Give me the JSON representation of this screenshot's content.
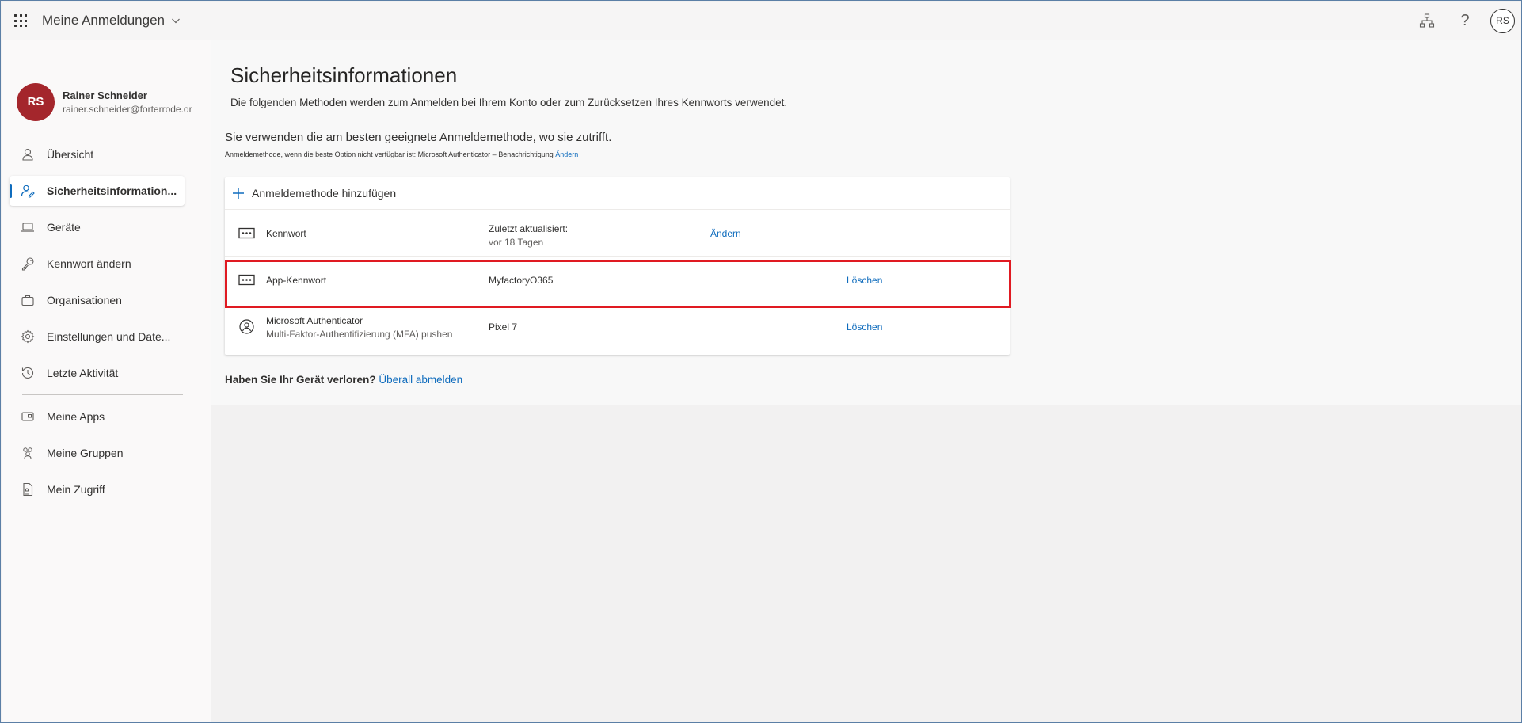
{
  "header": {
    "app_title": "Meine Anmeldungen",
    "help_label": "?",
    "avatar_initials": "RS"
  },
  "sidebar": {
    "user": {
      "initials": "RS",
      "name": "Rainer Schneider",
      "email": "rainer.schneider@forterrode.or"
    },
    "items": [
      {
        "label": "Übersicht",
        "icon": "person-icon"
      },
      {
        "label": "Sicherheitsinformation...",
        "icon": "security-info-icon",
        "active": true
      },
      {
        "label": "Geräte",
        "icon": "laptop-icon"
      },
      {
        "label": "Kennwort ändern",
        "icon": "key-icon"
      },
      {
        "label": "Organisationen",
        "icon": "briefcase-icon"
      },
      {
        "label": "Einstellungen und Date...",
        "icon": "gear-icon"
      },
      {
        "label": "Letzte Aktivität",
        "icon": "history-icon"
      }
    ],
    "secondary_items": [
      {
        "label": "Meine Apps",
        "icon": "apps-icon"
      },
      {
        "label": "Meine Gruppen",
        "icon": "groups-icon"
      },
      {
        "label": "Mein Zugriff",
        "icon": "access-icon"
      }
    ]
  },
  "main": {
    "title": "Sicherheitsinformationen",
    "subtitle": "Die folgenden Methoden werden zum Anmelden bei Ihrem Konto oder zum Zurücksetzen Ihres Kennworts verwendet.",
    "default_method_text": "Sie verwenden die am besten geeignete Anmeldemethode, wo sie zutrifft.",
    "default_method_small": "Anmeldemethode, wenn die beste Option nicht verfügbar ist: Microsoft Authenticator – Benachrichtigung",
    "default_method_change": "Ändern",
    "add_method_label": "Anmeldemethode hinzufügen",
    "methods": [
      {
        "name": "Kennwort",
        "detail": "Zuletzt aktualisiert:",
        "detail_sub": "vor 18 Tagen",
        "action": "Ändern",
        "icon": "password-dots-icon"
      },
      {
        "name": "App-Kennwort",
        "detail": "MyfactoryO365",
        "action": "Löschen",
        "icon": "password-dots-icon"
      },
      {
        "name": "Microsoft Authenticator",
        "name_sub": "Multi-Faktor-Authentifizierung (MFA) pushen",
        "detail": "Pixel 7",
        "action": "Löschen",
        "icon": "authenticator-icon"
      }
    ],
    "lost_device_question": "Haben Sie Ihr Gerät verloren?",
    "lost_device_link": "Überall abmelden"
  },
  "colors": {
    "accent": "#0f6cbd",
    "avatar": "#a4262c",
    "highlight": "#e01a22"
  }
}
